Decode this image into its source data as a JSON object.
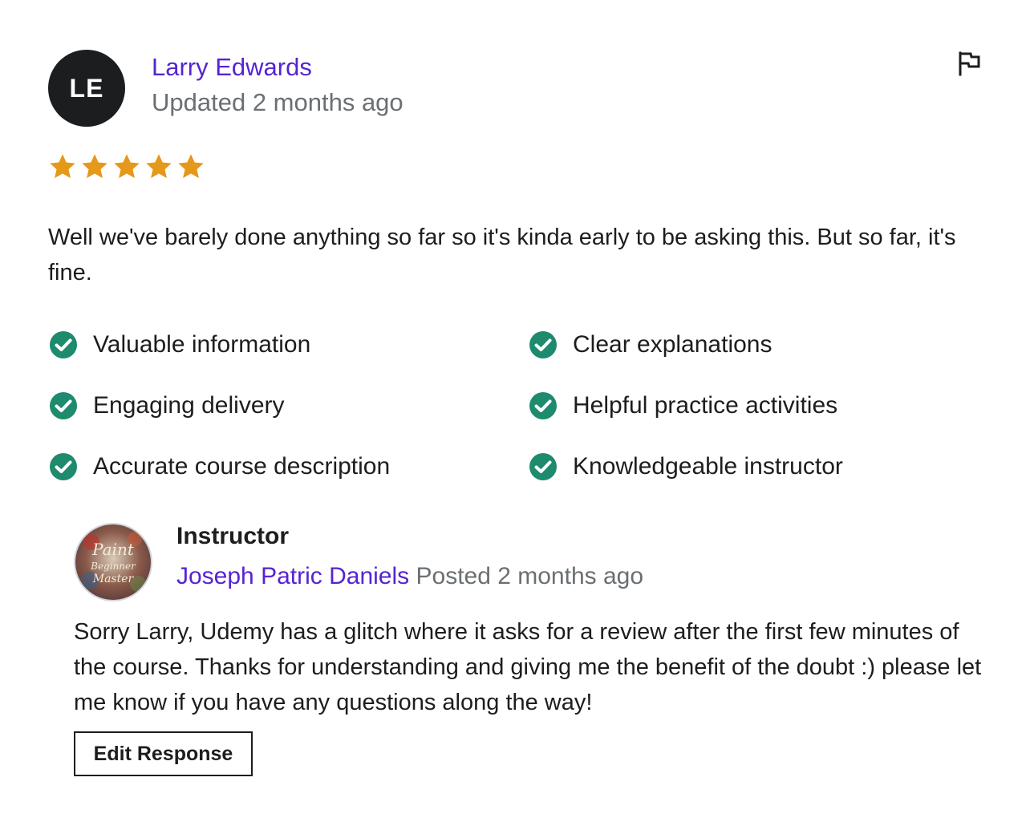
{
  "review": {
    "avatar_initials": "LE",
    "reviewer_name": "Larry Edwards",
    "updated_text": "Updated 2 months ago",
    "rating": 5,
    "rating_max": 5,
    "star_color": "#e59819",
    "body": "Well we've barely done anything so far so it's kinda early to be asking this. But so far, it's fine.",
    "flag_icon": "flag-icon"
  },
  "tags": [
    {
      "label": "Valuable information"
    },
    {
      "label": "Clear explanations"
    },
    {
      "label": "Engaging delivery"
    },
    {
      "label": "Helpful practice activities"
    },
    {
      "label": "Accurate course description"
    },
    {
      "label": "Knowledgeable instructor"
    }
  ],
  "tag_check_color": "#1e8a6e",
  "response": {
    "role": "Instructor",
    "instructor_name": "Joseph Patric Daniels",
    "posted_text": "Posted 2 months ago",
    "avatar_text": [
      "Paint",
      "Beginner",
      "Master"
    ],
    "body": "Sorry Larry, Udemy has a glitch where it asks for a review after the first few minutes of the course. Thanks for understanding and giving me the benefit of the doubt :) please let me know if you have any questions along the way!",
    "edit_button": "Edit Response"
  },
  "colors": {
    "link": "#5624d0",
    "muted": "#6a6f73",
    "text": "#1c1d1f"
  }
}
